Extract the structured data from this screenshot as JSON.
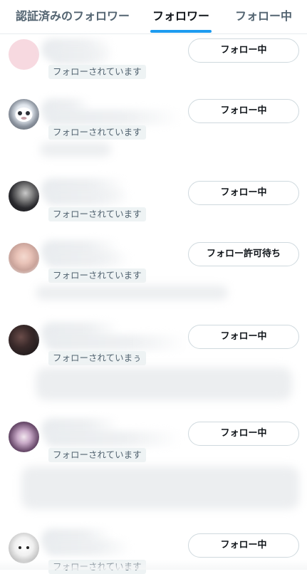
{
  "tabs": {
    "verified_followers": "認証済みのフォロワー",
    "followers": "フォロワー",
    "following": "フォロー中",
    "active": "followers"
  },
  "colors": {
    "accent": "#1d9bf0",
    "text_primary": "#0f1419",
    "text_secondary": "#536471",
    "button_border": "#cfd9de",
    "follows_you_bg": "#eef3f4"
  },
  "rows": [
    {
      "follows_you_label": "フォローされています",
      "button_label": "フォロー中"
    },
    {
      "follows_you_label": "フォローされています",
      "button_label": "フォロー中"
    },
    {
      "follows_you_label": "フォローされています",
      "button_label": "フォロー中"
    },
    {
      "follows_you_label": "フォローされています",
      "button_label": "フォロー許可待ち"
    },
    {
      "follows_you_label": "フォローされていまぅ",
      "button_label": "フォロー中"
    },
    {
      "follows_you_label": "フォローされています",
      "button_label": "フォロー中"
    },
    {
      "follows_you_label": "フォローされています",
      "button_label": "フォロー中"
    }
  ]
}
